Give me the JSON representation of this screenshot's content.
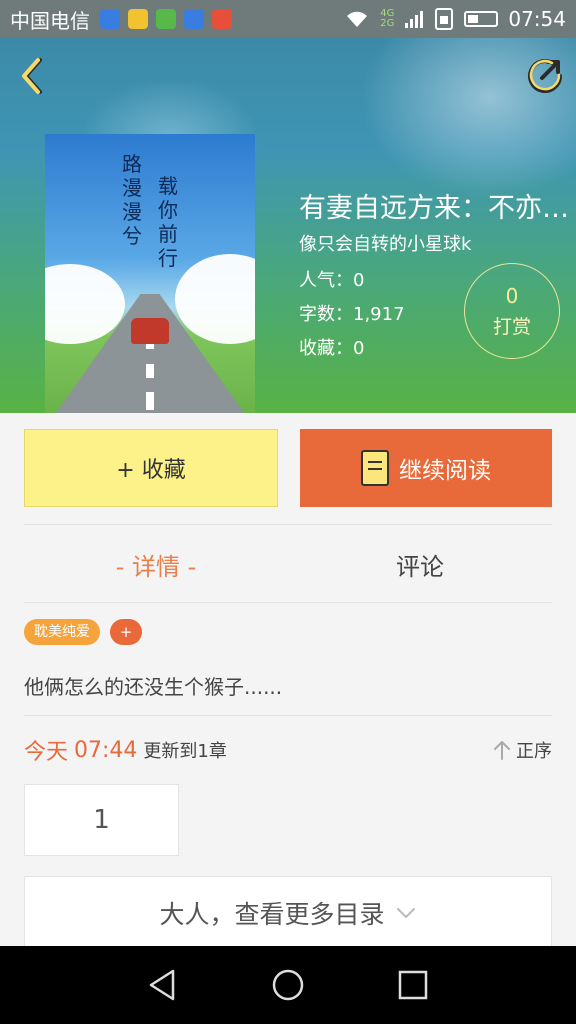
{
  "status_bar": {
    "carrier": "中国电信",
    "network_top": "4G",
    "network_bottom": "2G",
    "time": "07:54",
    "app_icons": [
      "shield-icon",
      "star-icon",
      "chat-icon",
      "shield-icon",
      "music-icon"
    ]
  },
  "book": {
    "title": "有妻自远方来：不亦…",
    "author": "像只会自转的小星球k",
    "popularity_label": "人气：",
    "popularity_value": "0",
    "words_label": "字数：",
    "words_value": "1,917",
    "favorites_label": "收藏：",
    "favorites_value": "0",
    "cover_poem_col1": "路漫漫兮",
    "cover_poem_col2": "载你前行"
  },
  "tip": {
    "count": "0",
    "label": "打赏"
  },
  "actions": {
    "favorite_label": "+ 收藏",
    "read_label": "继续阅读"
  },
  "tabs": [
    {
      "label": "- 详情 -",
      "active": true
    },
    {
      "label": "评论",
      "active": false
    }
  ],
  "tags": {
    "genre": "耽美纯爱",
    "add": "+"
  },
  "description": "他俩怎么的还没生个猴子......",
  "update": {
    "day": "今天",
    "time": "07:44",
    "info": "更新到1章",
    "sort_label": "正序"
  },
  "chapters": {
    "current": "1"
  },
  "more": {
    "label": "大人，查看更多目录"
  },
  "colors": {
    "accent": "#e8693a",
    "favorite_bg": "#fdf28a",
    "tag_genre": "#f5a43c"
  }
}
